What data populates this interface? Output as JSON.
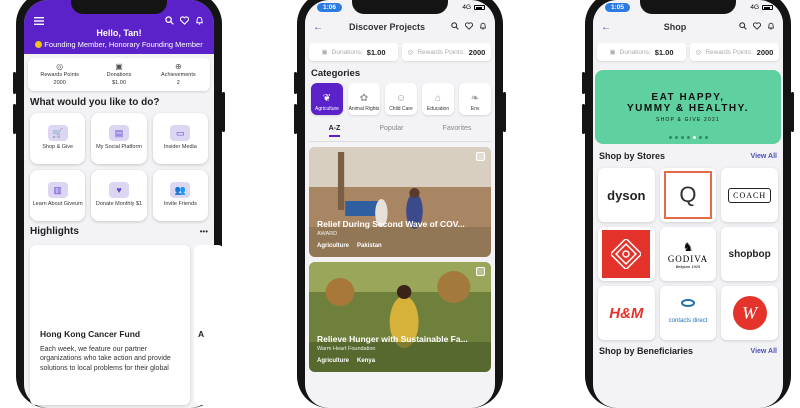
{
  "phone1": {
    "time": "",
    "greeting": "Hello, Tan!",
    "membership": "Founding Member, Honorary Founding Member",
    "stats": [
      {
        "label": "Rewards Points",
        "value": "2000",
        "icon": "coin-icon"
      },
      {
        "label": "Donations",
        "value": "$1.00",
        "icon": "wallet-icon"
      },
      {
        "label": "Achievements",
        "value": "2",
        "icon": "globe-icon"
      }
    ],
    "section_title": "What would you like to do?",
    "tiles": [
      {
        "label": "Shop & Give",
        "icon": "cart-icon"
      },
      {
        "label": "My Social Platform",
        "icon": "social-icon"
      },
      {
        "label": "Insider Media",
        "icon": "media-icon"
      },
      {
        "label": "Learn About Giveum",
        "icon": "book-icon"
      },
      {
        "label": "Donate Monthly $1",
        "icon": "donate-icon"
      },
      {
        "label": "Invite Friends",
        "icon": "friends-icon"
      }
    ],
    "highlights_title": "Highlights",
    "highlights_more": "•••",
    "highlight_card": {
      "title": "Hong Kong Cancer Fund",
      "body": "Each week, we feature our partner organizations who take action and provide solutions to local problems for their global"
    },
    "highlight_card2_initial": "A"
  },
  "phone2": {
    "time": "1:06",
    "network": "4G",
    "title": "Discover Projects",
    "donations_label": "Donations:",
    "donations_value": "$1.00",
    "rewards_label": "Rewards Points:",
    "rewards_value": "2000",
    "categories_title": "Categories",
    "categories": [
      "Agriculture",
      "Animal Rights",
      "Child Care",
      "Education",
      "Env"
    ],
    "tabs": [
      "A-Z",
      "Popular",
      "Favorites"
    ],
    "projects": [
      {
        "title": "Relief During Second Wave of COV...",
        "org": "AWARD",
        "tags": [
          "Agriculture",
          "Pakistan"
        ]
      },
      {
        "title": "Relieve Hunger with Sustainable Fa...",
        "org": "Warm Heart Foundation",
        "tags": [
          "Agriculture",
          "Kenya"
        ]
      }
    ]
  },
  "phone3": {
    "time": "1:05",
    "network": "4G",
    "title": "Shop",
    "donations_label": "Donations:",
    "donations_value": "$1.00",
    "rewards_label": "Rewards Points:",
    "rewards_value": "2000",
    "banner_line1a": "EAT HAPPY,",
    "banner_line1b": "YUMMY & HEALTHY.",
    "banner_line2": "SHOP & GIVE 2021",
    "stores_title": "Shop by Stores",
    "view_all": "View All",
    "stores": [
      "dyson",
      "Q",
      "COACH",
      "",
      "GODIVA",
      "shopbop",
      "H&M",
      "contacts direct",
      "W"
    ],
    "godiva_sub": "Belgium 1926",
    "beneficiaries_title": "Shop by Beneficiaries",
    "view_all2": "View All"
  }
}
